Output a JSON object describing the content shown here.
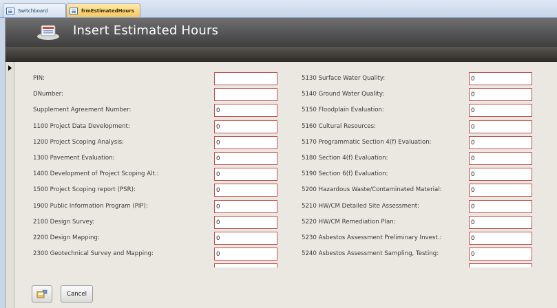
{
  "tabs": [
    {
      "label": "Switchboard",
      "active": false
    },
    {
      "label": "frmEstimatedHours",
      "active": true
    }
  ],
  "header": {
    "title": "Insert Estimated Hours"
  },
  "left_fields": [
    {
      "label": "PIN:",
      "value": ""
    },
    {
      "label": "DNumber:",
      "value": ""
    },
    {
      "label": "Supplement Agreement Number:",
      "value": "0"
    },
    {
      "label": "1100 Project Data Development:",
      "value": "0"
    },
    {
      "label": "1200 Project Scoping Analysis:",
      "value": "0"
    },
    {
      "label": "1300 Pavement Evaluation:",
      "value": "0"
    },
    {
      "label": "1400 Development of Project Scoping Alt.:",
      "value": "0"
    },
    {
      "label": "1500 Project Scoping report (PSR):",
      "value": "0"
    },
    {
      "label": "1900 Public Information Program (PIP):",
      "value": "0"
    },
    {
      "label": "2100 Design Survey:",
      "value": "0"
    },
    {
      "label": "2200 Design Mapping:",
      "value": "0"
    },
    {
      "label": "2300 Geotechnical Survey and Mapping:",
      "value": "0"
    }
  ],
  "right_fields": [
    {
      "label": "5130 Surface Water Quality:",
      "value": "0"
    },
    {
      "label": "5140 Ground Water Quality:",
      "value": "0"
    },
    {
      "label": "5150 Floodplain Evaluation:",
      "value": "0"
    },
    {
      "label": "5160 Cultural Resources:",
      "value": "0"
    },
    {
      "label": "5170 Programmatic Section 4(f) Evaluation:",
      "value": "0"
    },
    {
      "label": "5180 Section 4(f) Evaluation:",
      "value": "0"
    },
    {
      "label": "5190 Section 6(f) Evaluation:",
      "value": "0"
    },
    {
      "label": "5200 Hazardous Waste/Contaminated Material:",
      "value": "0"
    },
    {
      "label": "5210 HW/CM Detailed Site Assessment:",
      "value": "0"
    },
    {
      "label": "5220 HW/CM Remediation Plan:",
      "value": "0"
    },
    {
      "label": "5230 Asbestos Assessment Preliminary Invest.:",
      "value": "0"
    },
    {
      "label": "5240 Asbestos Assessment Sampling, Testing:",
      "value": "0"
    }
  ],
  "buttons": {
    "save_icon": "save-record-icon",
    "cancel_label": "Cancel"
  },
  "colors": {
    "field_border": "#c0504d",
    "header_bg": "#4a4a4a",
    "form_bg": "#ebe8e2",
    "active_tab": "#f6c760"
  }
}
